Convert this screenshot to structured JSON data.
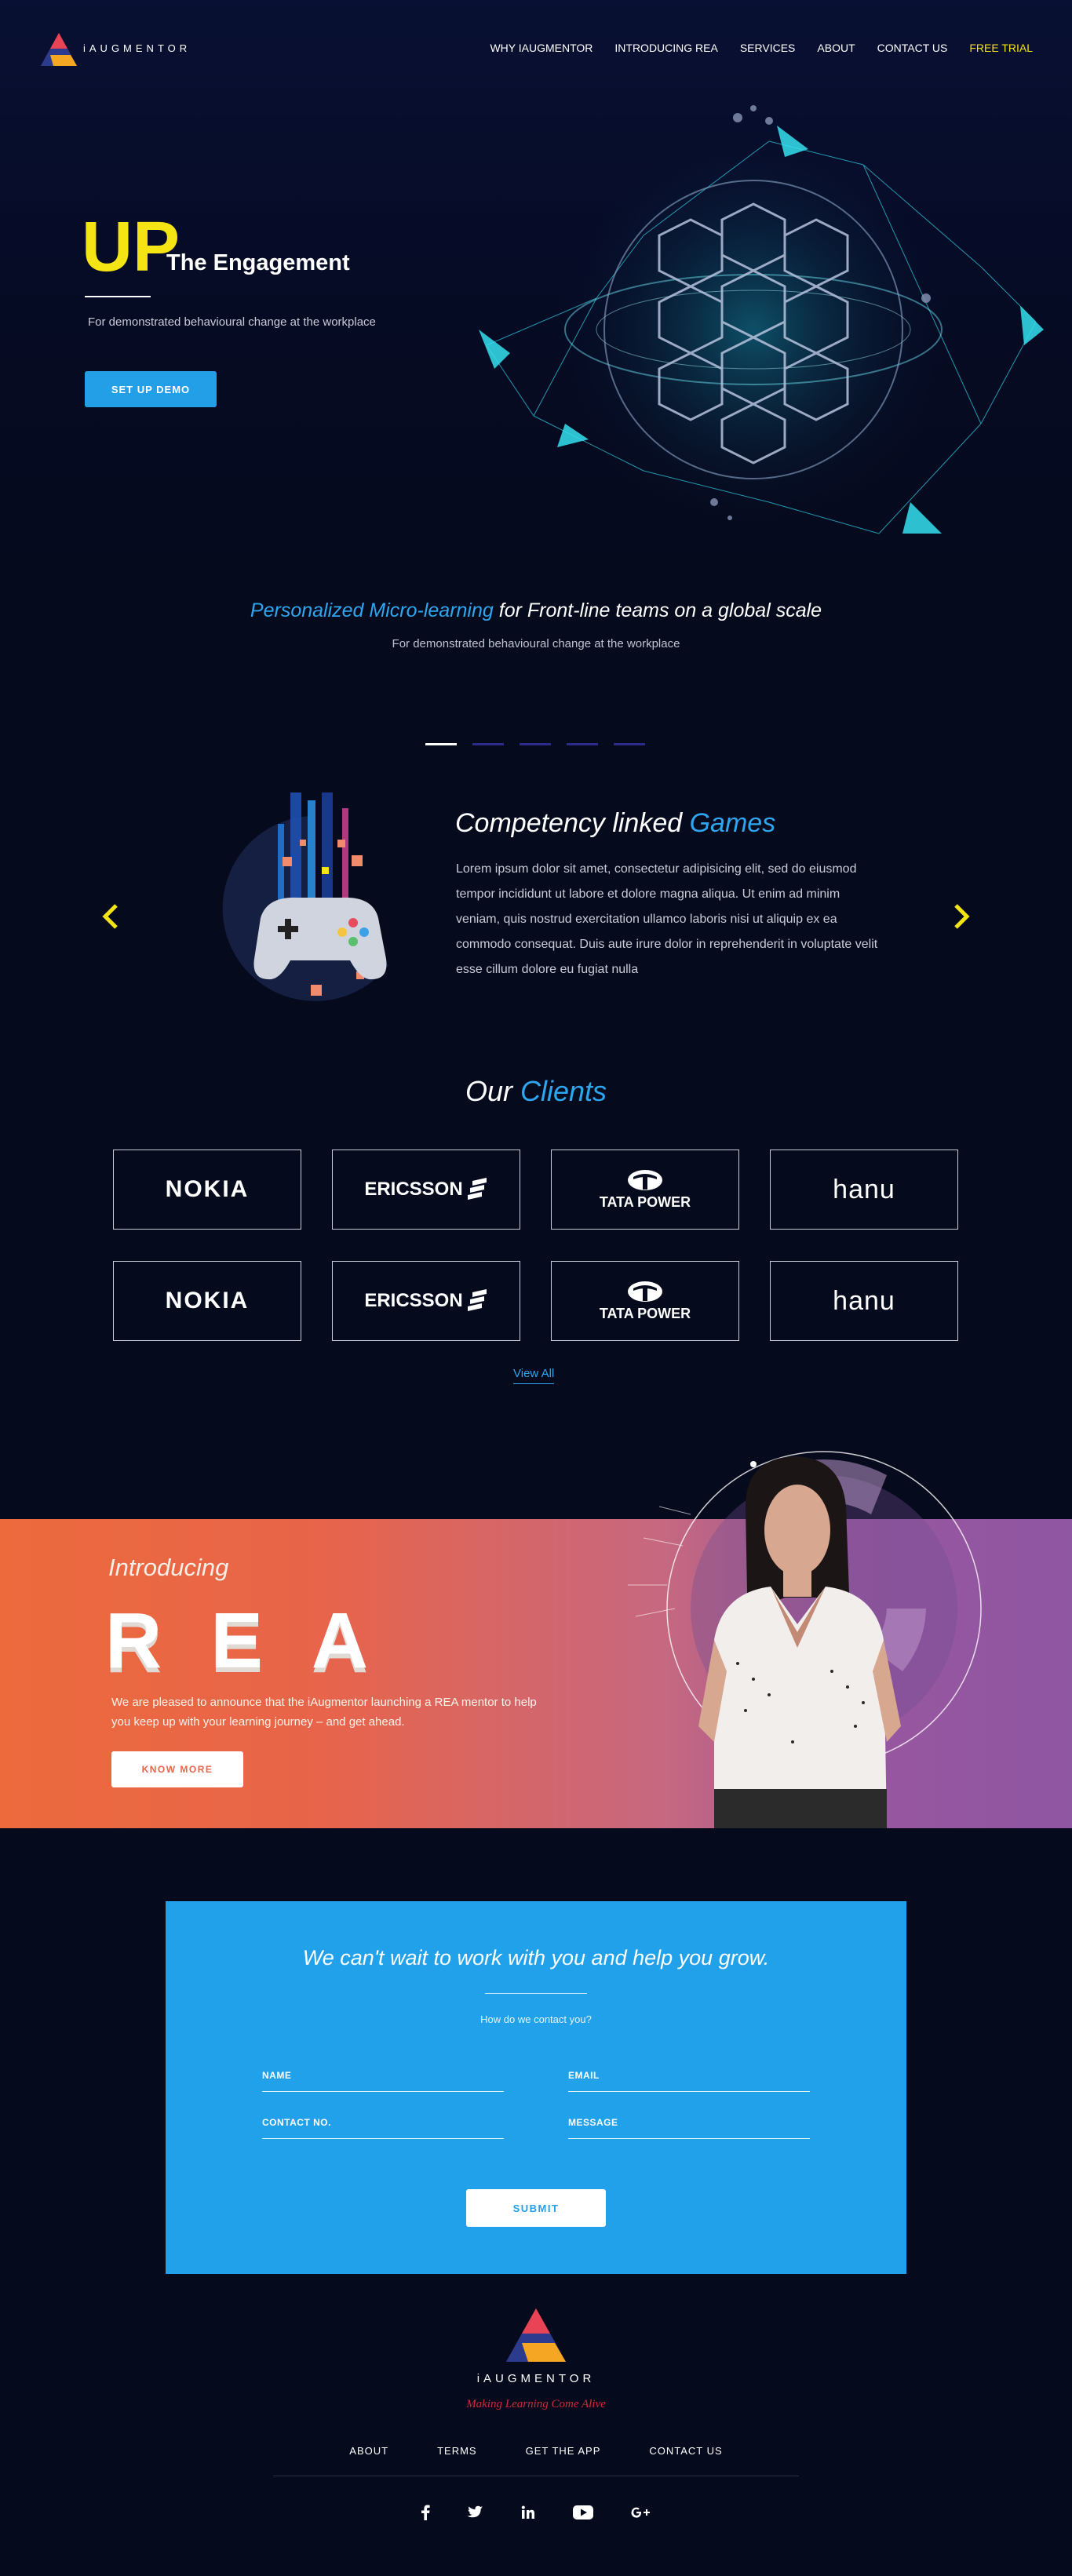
{
  "header": {
    "logo_text": "iAUGMENTOR",
    "nav": [
      "WHY IAUGMENTOR",
      "INTRODUCING REA",
      "SERVICES",
      "ABOUT",
      "CONTACT US"
    ],
    "nav_cta": "FREE TRIAL"
  },
  "hero": {
    "up": "UP",
    "title": "The Engagement",
    "subtitle": "For demonstrated behavioural change at the workplace",
    "button": "SET UP DEMO"
  },
  "micro": {
    "title_highlight": "Personalized Micro-learning",
    "title_rest": " for Front-line teams on a global scale",
    "subtitle": "For demonstrated behavioural change at the workplace"
  },
  "slider": {
    "active_index": 0,
    "slide_count": 5,
    "title": "Competency linked ",
    "title_highlight": "Games",
    "body": "Lorem ipsum dolor sit amet, consectetur adipisicing elit, sed do eiusmod tempor incididunt ut labore et dolore magna aliqua. Ut enim ad minim veniam, quis nostrud exercitation ullamco laboris nisi ut aliquip ex ea commodo consequat. Duis aute irure dolor in reprehenderit in voluptate velit esse cillum dolore eu fugiat nulla"
  },
  "clients": {
    "title": "Our ",
    "title_highlight": "Clients",
    "logos": [
      "NOKIA",
      "ERICSSON",
      "TATA POWER",
      "hanu",
      "NOKIA",
      "ERICSSON",
      "TATA POWER",
      "hanu"
    ],
    "view_all": "View All"
  },
  "rea": {
    "intro": "Introducing",
    "name": "REA",
    "text": "We are pleased to announce that the iAugmentor launching a REA mentor to help you keep up with your learning journey – and get ahead.",
    "button": "KNOW MORE"
  },
  "contact": {
    "title": "We can't wait to work with you and help you grow.",
    "subtitle": "How do we contact you?",
    "fields": [
      "NAME",
      "EMAIL",
      "CONTACT NO.",
      "MESSAGE"
    ],
    "button": "SUBMIT"
  },
  "footer": {
    "logo_text": "iAUGMENTOR",
    "tagline": "Making Learning Come Alive",
    "links": [
      "ABOUT",
      "TERMS",
      "GET THE APP",
      "CONTACT US"
    ],
    "social": [
      "facebook-icon",
      "twitter-icon",
      "linkedin-icon",
      "youtube-icon",
      "google-plus-icon"
    ]
  },
  "colors": {
    "accent_blue": "#239fe8",
    "accent_yellow": "#f5e413",
    "background": "#060a1d",
    "rea_orange": "#ec6a3c",
    "rea_purple": "#8f56a1"
  }
}
